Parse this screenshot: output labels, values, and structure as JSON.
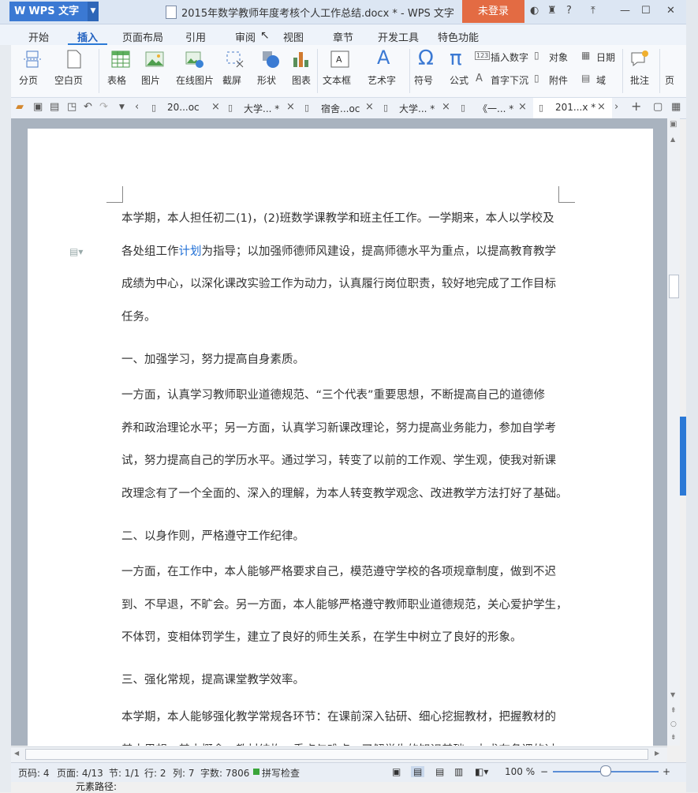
{
  "app": {
    "name": "WPS 文字",
    "title": "2015年数学教师年度考核个人工作总结.docx * - WPS 文字",
    "login": "未登录",
    "help": "?"
  },
  "menu_tabs": [
    "开始",
    "插入",
    "页面布局",
    "引用",
    "审阅",
    "视图",
    "章节",
    "开发工具",
    "特色功能"
  ],
  "ribbon": {
    "page_break": "分页",
    "blank_page": "空白页",
    "table": "表格",
    "picture": "图片",
    "online_picture": "在线图片",
    "screenshot": "截屏",
    "shape": "形状",
    "chart": "图表",
    "textbox": "文本框",
    "wordart": "艺术字",
    "symbol": "符号",
    "formula": "公式",
    "insert_number": "插入数字",
    "drop_cap": "首字下沉",
    "object": "对象",
    "attachment": "附件",
    "date": "日期",
    "field": "域",
    "comment": "批注",
    "page": "页"
  },
  "doc_tabs": [
    "20...oc",
    "大学... *",
    "宿舍...oc",
    "大学... *",
    "《一... *",
    "201...x *"
  ],
  "document": {
    "p1": [
      "本学期，本人担任初二(1)，(2)班数学课教学和班主任工作。一学期来，本人以学校及",
      "各处组工作",
      "计划",
      "为指导；以加强师德师风建设，提高师德水平为重点，以提高教育教学",
      "成绩为中心，以深化课改实验工作为动力，认真履行岗位职责，较好地完成了工作目标",
      "任务。"
    ],
    "h1": "一、加强学习，努力提高自身素质。",
    "p2": [
      "一方面，认真学习教师职业道德规范、“三个代表”重要思想，不断提高自己的道德修",
      "养和政治理论水平；另一方面，认真学习新课改理论，努力提高业务能力，参加自学考",
      "试，努力提高自己的学历水平。通过学习，转变了以前的工作观、学生观，使我对新课",
      "改理念有了一个全面的、深入的理解，为本人转变教学观念、改进教学方法打好了基础。"
    ],
    "h2": "二、以身作则，严格遵守工作纪律。",
    "p3": [
      "一方面，在工作中，本人能够严格要求自己，模范遵守学校的各项规章制度，做到不迟",
      "到、不早退，不旷会。另一方面，本人能够严格遵守教师职业道德规范，关心爱护学生，",
      "不体罚，变相体罚学生，建立了良好的师生关系，在学生中树立了良好的形象。"
    ],
    "h3": "三、强化常规，提高课堂教学效率。",
    "p4": [
      "本学期，本人能够强化教学常规各环节：在课前深入钻研、细心挖掘教材，把握教材的",
      "基本思想、基本概念、教材结构、重点与难点，了解学生的知识基础，力求在备课的过"
    ]
  },
  "status": {
    "page_no": "页码: 4",
    "pages": "页面: 4/13",
    "section": "节: 1/1",
    "row": "行: 2",
    "col": "列: 7",
    "words": "字数: 7806",
    "spell": "拼写检查",
    "zoom": "100 %"
  },
  "bottom": "元素路径:",
  "colors": {
    "accent": "#2b79d6",
    "login": "#e36b43",
    "link": "#1f6fd6"
  }
}
